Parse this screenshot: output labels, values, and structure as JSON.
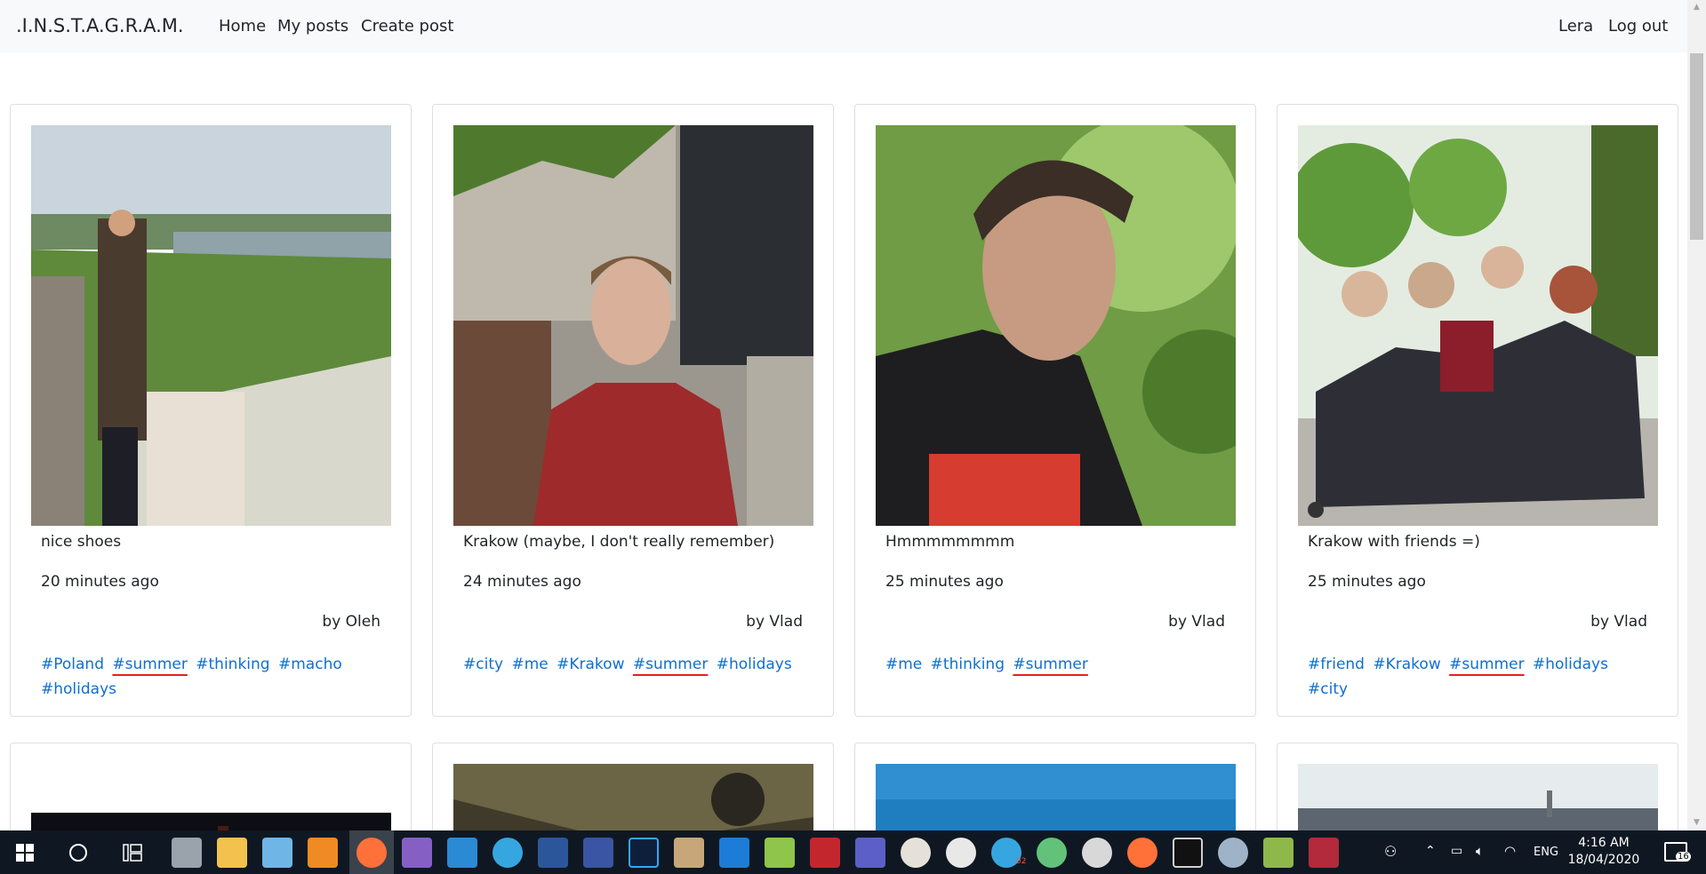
{
  "navbar": {
    "brand": ".I.N.S.T.A.G.R.A.M.",
    "links": [
      "Home",
      "My posts",
      "Create post"
    ],
    "user": "Lera",
    "logout": "Log out"
  },
  "posts": [
    {
      "caption": "nice shoes",
      "time": "20 minutes ago",
      "author": "by Oleh",
      "tags": [
        "#Poland",
        "#summer",
        "#thinking",
        "#macho",
        "#holidays"
      ]
    },
    {
      "caption": "Krakow (maybe, I don't really remember)",
      "time": "24 minutes ago",
      "author": "by Vlad",
      "tags": [
        "#city",
        "#me",
        "#Krakow",
        "#summer",
        "#holidays"
      ]
    },
    {
      "caption": "Hmmmmmmmm",
      "time": "25 minutes ago",
      "author": "by Vlad",
      "tags": [
        "#me",
        "#thinking",
        "#summer"
      ]
    },
    {
      "caption": "Krakow with friends =)",
      "time": "25 minutes ago",
      "author": "by Vlad",
      "tags": [
        "#friend",
        "#Krakow",
        "#summer",
        "#holidays",
        "#city"
      ]
    }
  ],
  "highlighted_tag": "#summer",
  "taskbar": {
    "lang": "ENG",
    "time": "4:16 AM",
    "date": "18/04/2020",
    "notifications": "16",
    "telegram_badge": "02",
    "icons": [
      "windows-start-icon",
      "search-circle-icon",
      "task-view-icon",
      "calculator-icon",
      "file-explorer-icon",
      "notepad-icon",
      "uc-browser-icon",
      "firefox-icon",
      "visual-studio-icon",
      "vscode-icon",
      "telegram-icon",
      "word-icon",
      "visio-icon",
      "photoshop-icon",
      "paint-icon",
      "shark-icon",
      "notepadpp-icon",
      "rm-icon",
      "teams-icon",
      "panda-icon",
      "slack-icon",
      "telegram2-icon",
      "atom-icon",
      "settings-icon",
      "firefox2-icon",
      "terminal-icon",
      "gear-icon",
      "map-icon",
      "video-icon"
    ]
  },
  "colors": {
    "tag": "#0f6fd1",
    "underline": "#e32121",
    "navbar_bg": "#f8f9fa",
    "taskbar_bg": "#0f1822"
  }
}
